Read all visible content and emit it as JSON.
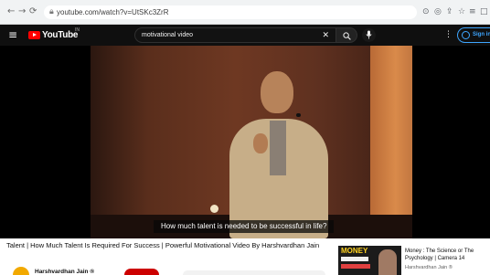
{
  "browser": {
    "back_icon": "back-arrow-icon",
    "forward_icon": "forward-arrow-icon",
    "reload_icon": "reload-icon",
    "url": "youtube.com/watch?v=UtSKc3ZrR"
  },
  "header": {
    "logo_text": "YouTube",
    "country_code": "IN",
    "search": {
      "value": "motivational video",
      "clear_glyph": "✕"
    },
    "signin_label": "Sign in"
  },
  "player": {
    "caption": "How much talent is needed to be successful in life?"
  },
  "video": {
    "title": "Talent | How Much Talent Is Required For Success | Powerful Motivational Video By Harshvardhan Jain",
    "channel": "Harshvardhan Jain ®"
  },
  "recommendation": {
    "thumb_label": "MONEY",
    "title": "Money : The Science or The Psychology | Camera 14",
    "channel": "Harshvardhan Jain ®"
  },
  "colors": {
    "youtube_red": "#ff0000",
    "header_bg": "#0f0f0f",
    "signin_blue": "#3ea6ff",
    "subscribe_red": "#cc0000"
  }
}
